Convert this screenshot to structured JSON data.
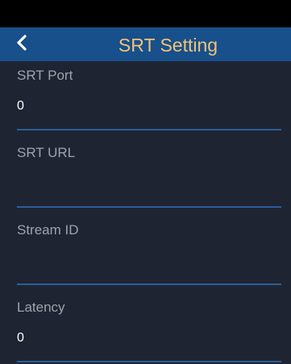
{
  "header": {
    "title": "SRT Setting",
    "back_icon": "chevron-left-icon"
  },
  "fields": [
    {
      "label": "SRT Port",
      "value": "0"
    },
    {
      "label": "SRT URL",
      "value": ""
    },
    {
      "label": "Stream ID",
      "value": ""
    },
    {
      "label": "Latency",
      "value": "0"
    }
  ],
  "colors": {
    "header_bg": "#17508a",
    "title": "#f3c27a",
    "background": "#1f2433",
    "divider": "#2a5f96",
    "label": "#a0a3aa"
  }
}
